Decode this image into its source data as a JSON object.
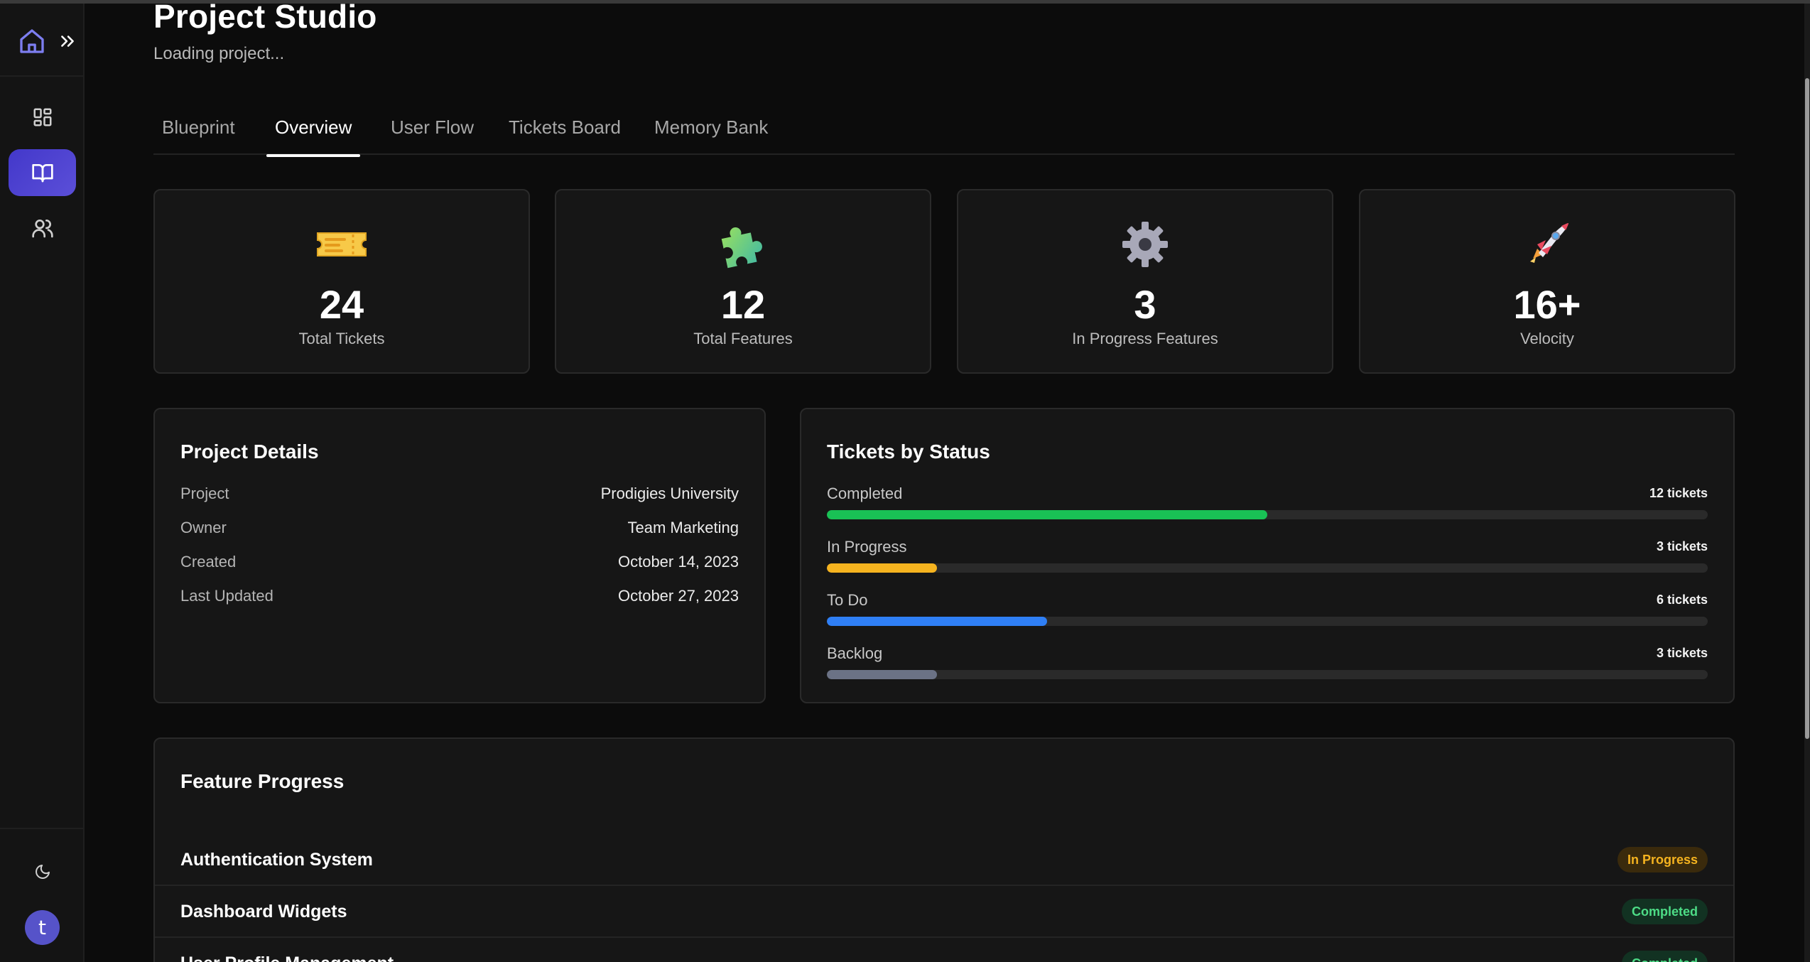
{
  "header": {
    "title": "Project Studio",
    "subtitle": "Loading project..."
  },
  "tabs": [
    {
      "label": "Blueprint",
      "active": false
    },
    {
      "label": "Overview",
      "active": true
    },
    {
      "label": "User Flow",
      "active": false
    },
    {
      "label": "Tickets Board",
      "active": false
    },
    {
      "label": "Memory Bank",
      "active": false
    }
  ],
  "sidebar": {
    "top_icons": [
      "home-icon",
      "chevrons-right-icon"
    ],
    "nav_icons": [
      "dashboard-grid-icon",
      "book-open-icon",
      "users-icon"
    ],
    "active_nav": "book-open-icon",
    "theme_icon": "moon-icon",
    "avatar_letter": "t"
  },
  "stats": [
    {
      "icon": "ticket-icon",
      "value": "24",
      "label": "Total Tickets"
    },
    {
      "icon": "puzzle-icon",
      "value": "12",
      "label": "Total Features"
    },
    {
      "icon": "gear-icon",
      "value": "3",
      "label": "In Progress Features"
    },
    {
      "icon": "rocket-icon",
      "value": "16+",
      "label": "Velocity"
    }
  ],
  "project_details": {
    "title": "Project Details",
    "rows": [
      {
        "key": "Project",
        "value": "Prodigies University"
      },
      {
        "key": "Owner",
        "value": "Team Marketing"
      },
      {
        "key": "Created",
        "value": "October 14, 2023"
      },
      {
        "key": "Last Updated",
        "value": "October 27, 2023"
      }
    ]
  },
  "tickets_by_status": {
    "title": "Tickets by Status",
    "rows": [
      {
        "label": "Completed",
        "count": "12 tickets",
        "fraction": 0.5,
        "color": "#19c155"
      },
      {
        "label": "In Progress",
        "count": "3 tickets",
        "fraction": 0.125,
        "color": "#f5b31f"
      },
      {
        "label": "To Do",
        "count": "6 tickets",
        "fraction": 0.25,
        "color": "#2f7ff5"
      },
      {
        "label": "Backlog",
        "count": "3 tickets",
        "fraction": 0.125,
        "color": "#6b7285"
      }
    ]
  },
  "feature_progress": {
    "title": "Feature Progress",
    "rows": [
      {
        "name": "Authentication System",
        "status": "In Progress"
      },
      {
        "name": "Dashboard Widgets",
        "status": "Completed"
      },
      {
        "name": "User Profile Management",
        "status": "Completed"
      }
    ]
  },
  "colors": {
    "accent": "#4f46e5",
    "background": "#0c0c0c",
    "card": "#161616"
  }
}
